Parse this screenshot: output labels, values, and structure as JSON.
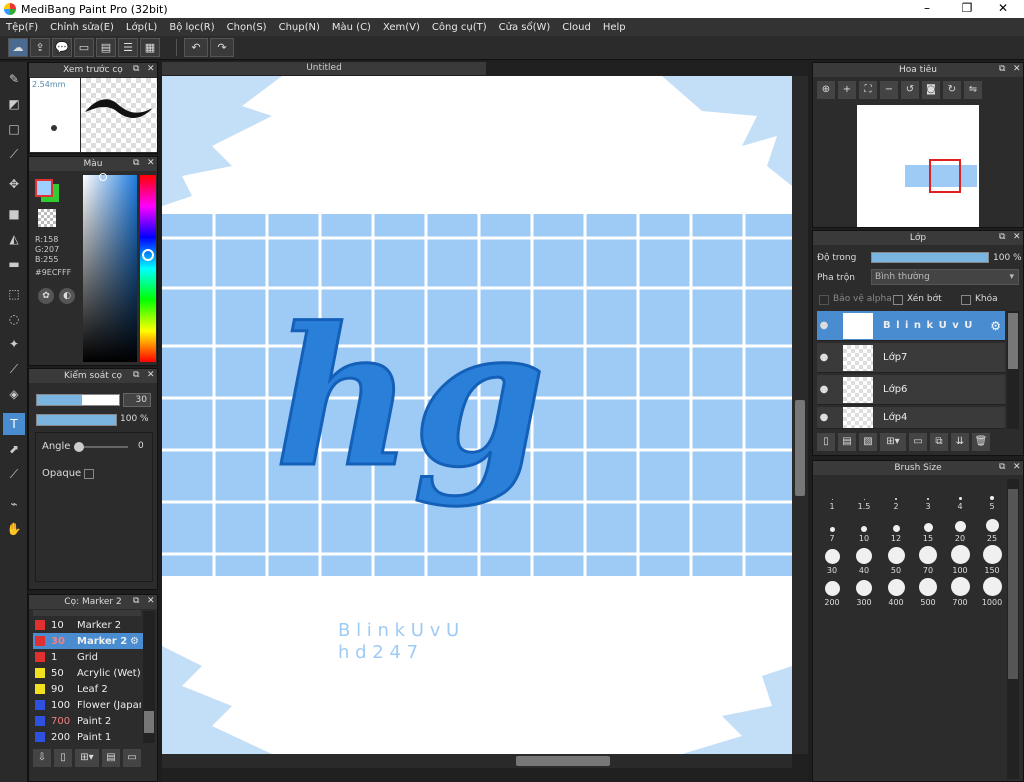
{
  "window": {
    "title": "MediBang Paint Pro (32bit)",
    "minimize": "–",
    "maximize": "❐",
    "close": "✕"
  },
  "menu": [
    "Tệp(F)",
    "Chỉnh sửa(E)",
    "Lớp(L)",
    "Bộ lọc(R)",
    "Chọn(S)",
    "Chụp(N)",
    "Màu (C)",
    "Xem(V)",
    "Công cụ(T)",
    "Cửa sổ(W)",
    "Cloud",
    "Help"
  ],
  "toolbar": {
    "undo": "↶",
    "redo": "↷"
  },
  "brush_preview": {
    "title": "Xem trước cọ",
    "size": "2.54mm"
  },
  "color_panel": {
    "title": "Màu",
    "r": "R:158",
    "g": "G:207",
    "b": "B:255",
    "hex": "#9ECFFF",
    "primary": "#9ECFFF",
    "secondary": "#33cc33"
  },
  "brush_control": {
    "title": "Kiểm soát cọ",
    "size_value": "30",
    "opacity_value": "100 %",
    "angle_label": "Angle",
    "angle_value": "0",
    "opaque_label": "Opaque"
  },
  "brush_list": {
    "title": "Cọ: Marker 2",
    "items": [
      {
        "num": "10",
        "name": "Marker 2",
        "color": "#e03030",
        "selected": false
      },
      {
        "num": "30",
        "name": "Marker 2",
        "color": "#e03030",
        "selected": true
      },
      {
        "num": "1",
        "name": "Grid",
        "color": "#e03030",
        "selected": false
      },
      {
        "num": "50",
        "name": "Acrylic (Wet)",
        "color": "#f0e020",
        "selected": false
      },
      {
        "num": "90",
        "name": "Leaf 2",
        "color": "#f0e020",
        "selected": false
      },
      {
        "num": "100",
        "name": "Flower (Japanes",
        "color": "#3050e0",
        "selected": false
      },
      {
        "num": "700",
        "name": "Paint 2",
        "color": "#3050e0",
        "selected": false
      },
      {
        "num": "200",
        "name": "Paint 1",
        "color": "#3050e0",
        "selected": false
      }
    ]
  },
  "document": {
    "tab": "Untitled",
    "art_big": "hg",
    "art_line1": "B l i n k U v U",
    "art_line2": "h d 2 4 7"
  },
  "navigator": {
    "title": "Hoa tiêu"
  },
  "layers": {
    "title": "Lớp",
    "opacity_label": "Độ trong",
    "opacity_value": "100 %",
    "blend_label": "Pha trộn",
    "blend_value": "Bình thường",
    "protect_alpha": "Bảo vệ alpha",
    "clip": "Xén bớt",
    "lock": "Khóa",
    "items": [
      {
        "name": "B l i n k U v U",
        "selected": true
      },
      {
        "name": "Lớp7",
        "selected": false
      },
      {
        "name": "Lớp6",
        "selected": false
      },
      {
        "name": "Lớp4",
        "selected": false
      }
    ]
  },
  "brush_size": {
    "title": "Brush Size",
    "sizes": [
      "1",
      "1.5",
      "2",
      "3",
      "4",
      "5",
      "7",
      "10",
      "12",
      "15",
      "20",
      "25",
      "30",
      "40",
      "50",
      "70",
      "100",
      "150",
      "200",
      "300",
      "400",
      "500",
      "700",
      "1000"
    ]
  }
}
